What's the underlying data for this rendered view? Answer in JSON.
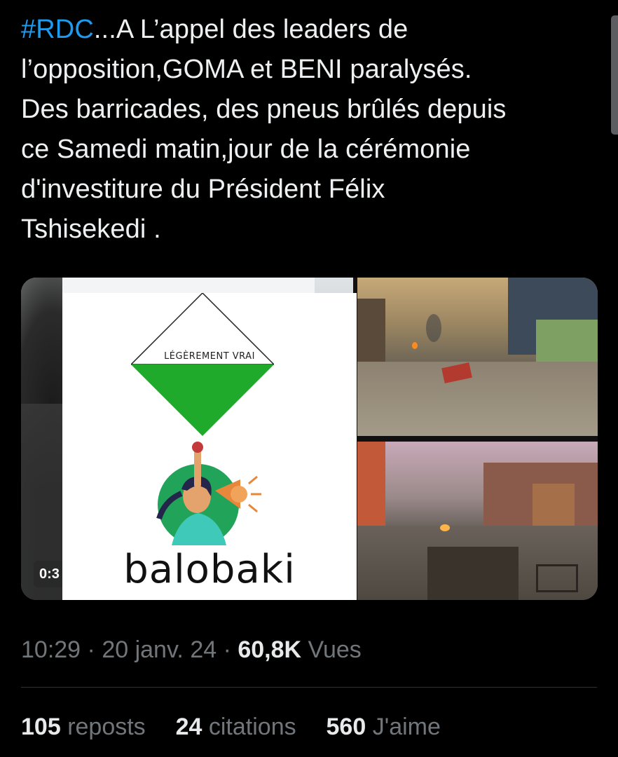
{
  "tweet": {
    "hashtag": "#RDC",
    "text": "...A L’appel des leaders de\nl’opposition,GOMA et BENI paralysés.\nDes barricades, des pneus brûlés depuis\nce Samedi matin,jour de la cérémonie\nd'investiture du Président Félix\nTshisekedi ."
  },
  "media": {
    "video_time": "0:3",
    "card": {
      "verdict": "LÉGÈREMENT VRAI",
      "brand": "balobaki"
    }
  },
  "meta": {
    "time": "10:29",
    "separator1": " · ",
    "date": "20 janv. 24",
    "separator2": " · ",
    "views_count": "60,8K",
    "views_label": "Vues"
  },
  "stats": {
    "reposts_count": "105",
    "reposts_label": "reposts",
    "quotes_count": "24",
    "quotes_label": "citations",
    "likes_count": "560",
    "likes_label": "J'aime"
  },
  "colors": {
    "hashtag": "#1d9bf0",
    "verdict_green": "#1faa2b",
    "background": "#000000",
    "muted": "#71767b"
  }
}
